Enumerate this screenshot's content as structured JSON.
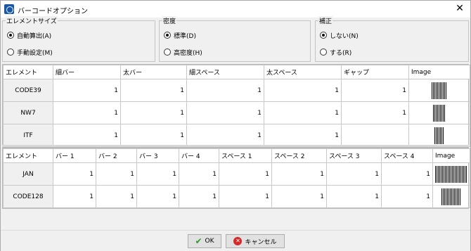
{
  "window": {
    "title": "バーコードオプション",
    "close_label": "✕"
  },
  "groups": {
    "element_size": {
      "legend": "エレメントサイズ",
      "options": [
        "自動算出(A)",
        "手動設定(M)"
      ],
      "selected": 0
    },
    "density": {
      "legend": "密度",
      "options": [
        "標準(D)",
        "高密度(H)"
      ],
      "selected": 0
    },
    "correction": {
      "legend": "補正",
      "options": [
        "しない(N)",
        "する(R)"
      ],
      "selected": 0
    }
  },
  "table1": {
    "headers": [
      "エレメント",
      "細バー",
      "太バー",
      "細スペース",
      "太スペース",
      "ギャップ",
      "Image"
    ],
    "rows": [
      {
        "name": "CODE39",
        "values": [
          "1",
          "1",
          "1",
          "1",
          "1"
        ]
      },
      {
        "name": "NW7",
        "values": [
          "1",
          "1",
          "1",
          "1",
          "1"
        ]
      },
      {
        "name": "ITF",
        "values": [
          "1",
          "1",
          "1",
          "1",
          ""
        ]
      }
    ]
  },
  "table2": {
    "headers": [
      "エレメント",
      "バー 1",
      "バー 2",
      "バー 3",
      "バー 4",
      "スペース 1",
      "スペース 2",
      "スペース 3",
      "スペース 4",
      "Image"
    ],
    "rows": [
      {
        "name": "JAN",
        "values": [
          "1",
          "1",
          "1",
          "1",
          "1",
          "1",
          "1",
          "1"
        ]
      },
      {
        "name": "CODE128",
        "values": [
          "1",
          "1",
          "1",
          "1",
          "1",
          "1",
          "1",
          "1"
        ]
      }
    ]
  },
  "buttons": {
    "ok": "OK",
    "cancel": "キャンセル"
  }
}
